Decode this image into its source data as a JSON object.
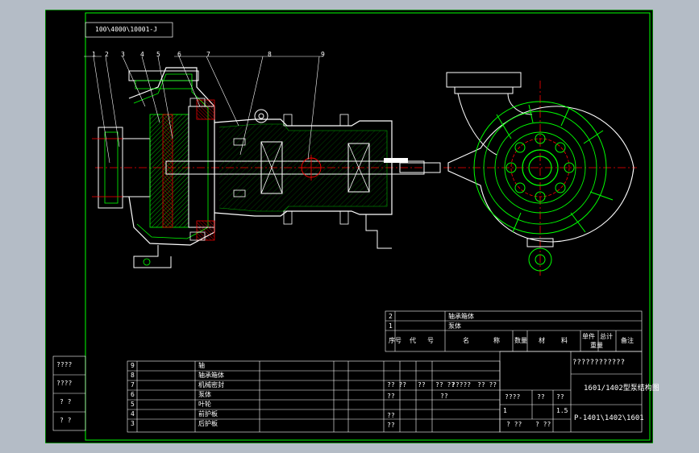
{
  "drawing": {
    "top_label": "100\\4000\\10001-J",
    "part_callouts": [
      "1",
      "2",
      "3",
      "4",
      "5",
      "6",
      "7",
      "8",
      "9"
    ],
    "side_labels": [
      "????",
      "????",
      "? ?",
      "? ?"
    ],
    "bom_rows": [
      {
        "no": "9",
        "name": "轴"
      },
      {
        "no": "8",
        "name": "轴承箱体"
      },
      {
        "no": "7",
        "name": "机械密封"
      },
      {
        "no": "6",
        "name": "泵体"
      },
      {
        "no": "5",
        "name": "叶轮"
      },
      {
        "no": "4",
        "name": "前护板"
      },
      {
        "no": "3",
        "name": "后护板"
      }
    ],
    "upper_table": {
      "rows": [
        {
          "no": "2",
          "name": "轴承箱体"
        },
        {
          "no": "1",
          "name": "泵体"
        }
      ],
      "header": [
        "序号",
        "代",
        "号",
        "名",
        "称",
        "数量",
        "材",
        "料",
        "单件",
        "总计",
        "备注"
      ],
      "header_sub": "重量"
    },
    "title_block": {
      "company": "????????????",
      "title": "1601/1402型泵结构图",
      "drawing_no": "P-1401\\1402\\1601",
      "scale": "1.5",
      "sheet": "1",
      "cells": [
        "?? ??",
        "??",
        "?? ??",
        "?????",
        "?? ??",
        "????",
        "??",
        "??",
        "??",
        "??",
        "? ??",
        "? ??"
      ]
    }
  },
  "colors": {
    "frame": "#00ff00",
    "lines": "#ffffff",
    "green": "#00ff00",
    "red": "#ff0000",
    "hatch": "#00ffff",
    "yellow": "#ffff00"
  }
}
